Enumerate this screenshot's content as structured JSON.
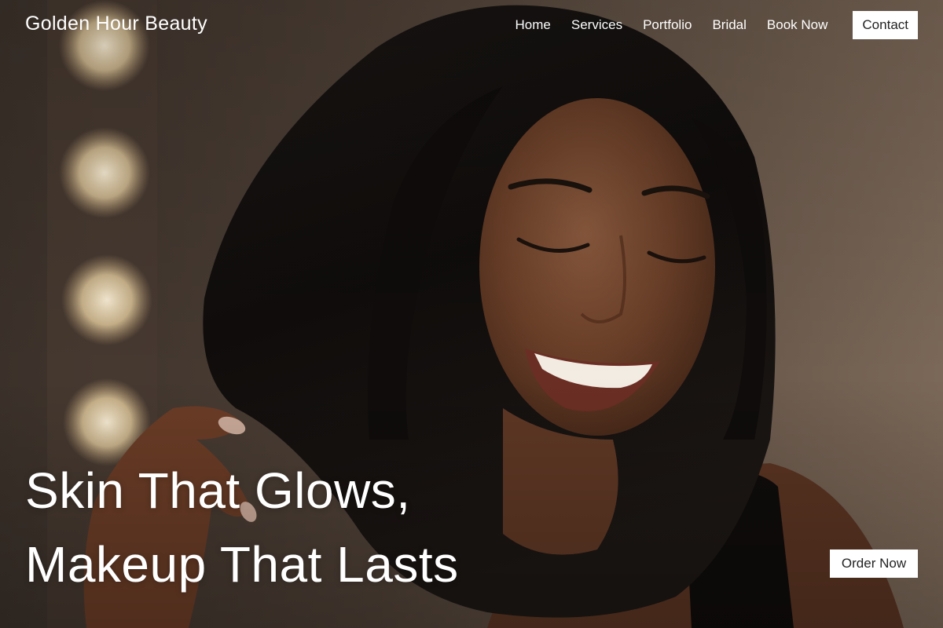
{
  "brand": {
    "name": "Golden Hour Beauty"
  },
  "nav": {
    "items": [
      {
        "label": "Home"
      },
      {
        "label": "Services"
      },
      {
        "label": "Portfolio"
      },
      {
        "label": "Bridal"
      },
      {
        "label": "Book Now"
      }
    ],
    "contact_label": "Contact"
  },
  "hero": {
    "headline_line1": "Skin That Glows,",
    "headline_line2": "Makeup That Lasts",
    "cta_label": "Order Now",
    "image_subject": "portrait-photo"
  },
  "colors": {
    "text": "#ffffff",
    "button_bg": "#ffffff",
    "button_text": "#222222",
    "background": "#5a4a3e"
  }
}
